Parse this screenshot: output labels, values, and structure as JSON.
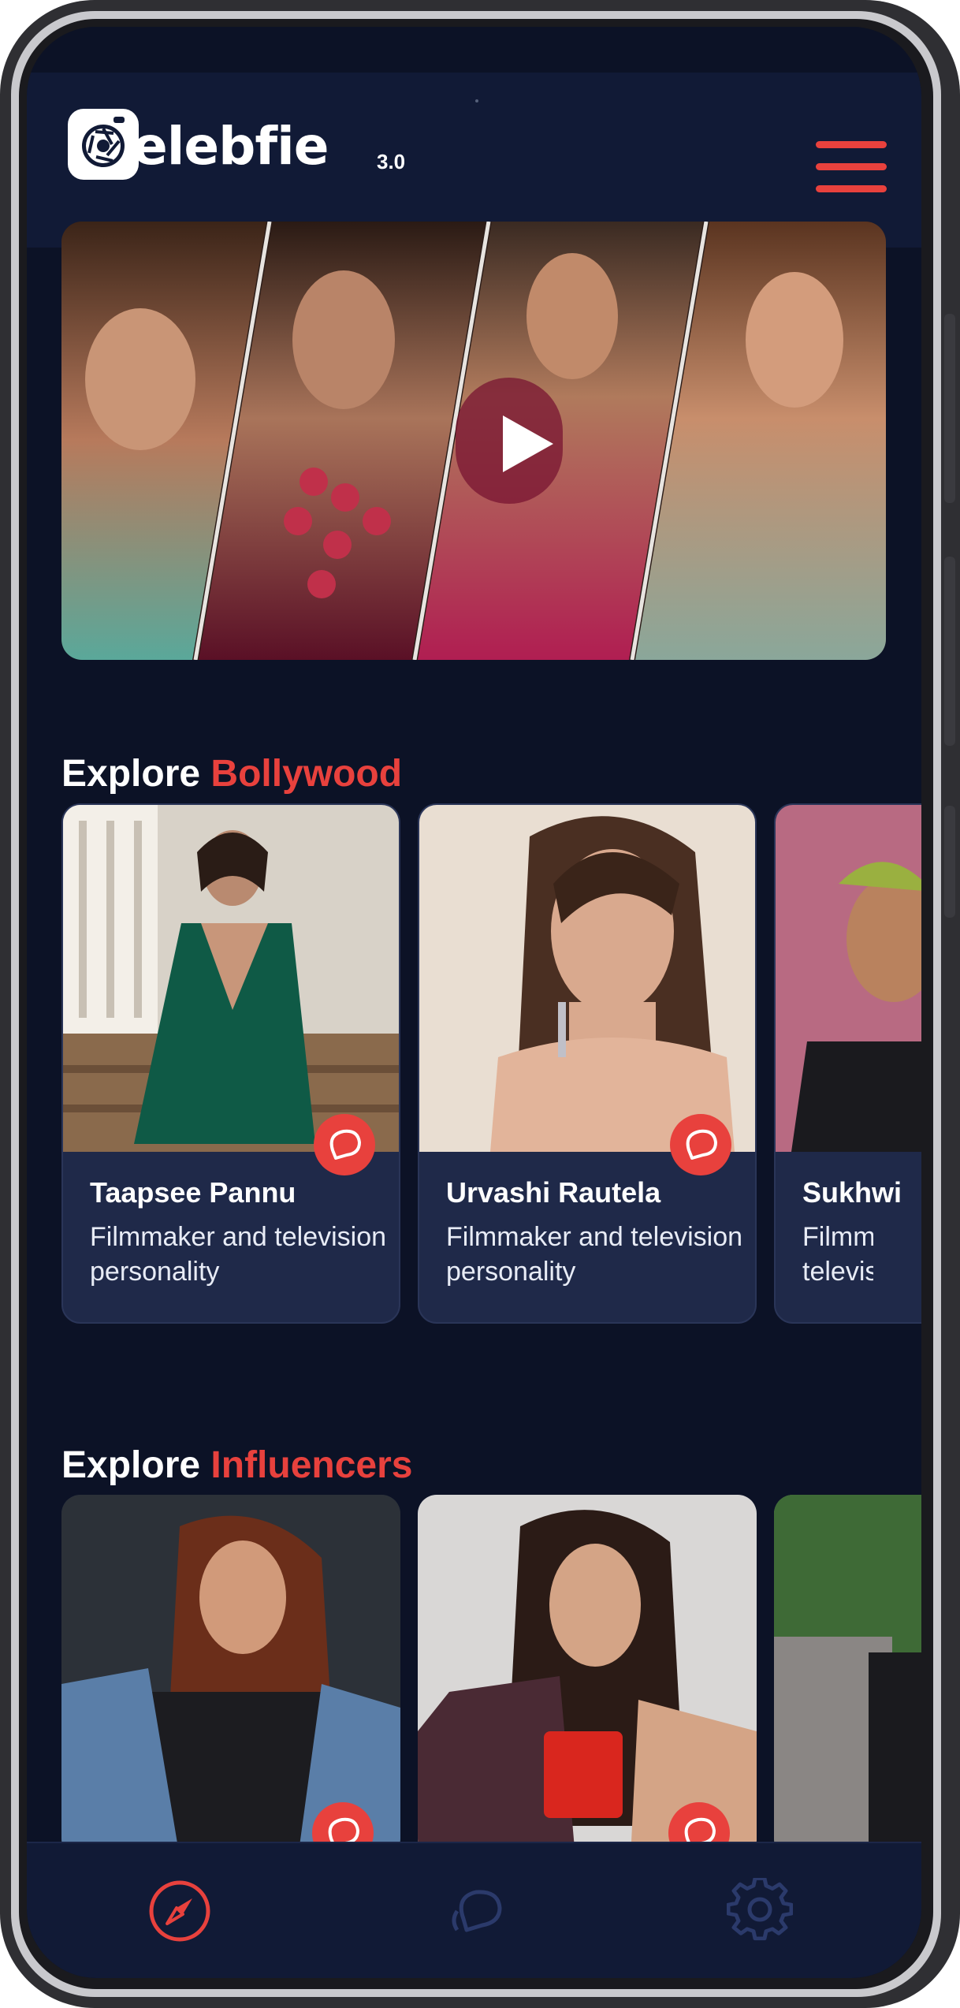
{
  "app": {
    "logo_text": "elebfie",
    "logo_version": "3.0"
  },
  "sections": [
    {
      "title_prefix": "Explore",
      "title_accent": "Bollywood",
      "cards": [
        {
          "name": "Taapsee Pannu",
          "description": "Filmmaker and television personality"
        },
        {
          "name": "Urvashi Rautela",
          "description": "Filmmaker and television personality"
        },
        {
          "name": "Sukhwi",
          "description": "Filmmal televisic"
        }
      ]
    },
    {
      "title_prefix": "Explore",
      "title_accent": "Influencers"
    }
  ],
  "icons": {
    "menu": "hamburger-menu-icon",
    "play": "play-icon",
    "chat": "chat-bubble-icon",
    "explore": "compass-icon",
    "settings": "gear-icon"
  },
  "colors": {
    "accent": "#e8413d",
    "background": "#0c1226",
    "card": "#1f2949",
    "nav_inactive": "#2b3a6b"
  }
}
